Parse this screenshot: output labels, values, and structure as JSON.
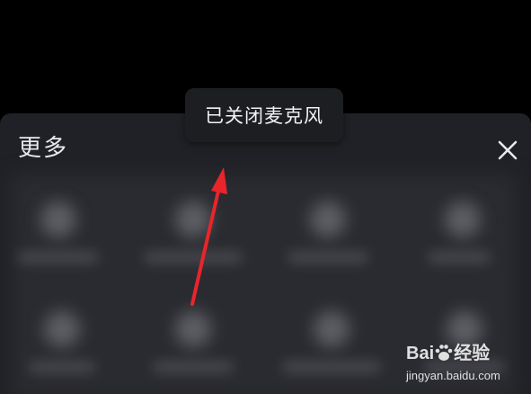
{
  "sheet": {
    "title": "更多",
    "close_icon": "close-icon",
    "grid_rows": [
      [
        {
          "icon": "blurred-icon"
        },
        {
          "icon": "blurred-icon"
        },
        {
          "icon": "blurred-icon"
        },
        {
          "icon": "blurred-icon"
        }
      ],
      [
        {
          "icon": "blurred-icon"
        },
        {
          "icon": "blurred-icon"
        },
        {
          "icon": "blurred-icon"
        },
        {
          "icon": "blurred-icon"
        }
      ]
    ]
  },
  "toast": {
    "text": "已关闭麦克风"
  },
  "annotation": {
    "arrow_color": "#e8252b"
  },
  "watermark": {
    "logo_prefix": "Bai",
    "logo_suffix": "经验",
    "url": "jingyan.baidu.com"
  },
  "colors": {
    "background": "#000000",
    "sheet": "#202126",
    "toast": "#1d1e22",
    "text": "#e9e9ec"
  }
}
